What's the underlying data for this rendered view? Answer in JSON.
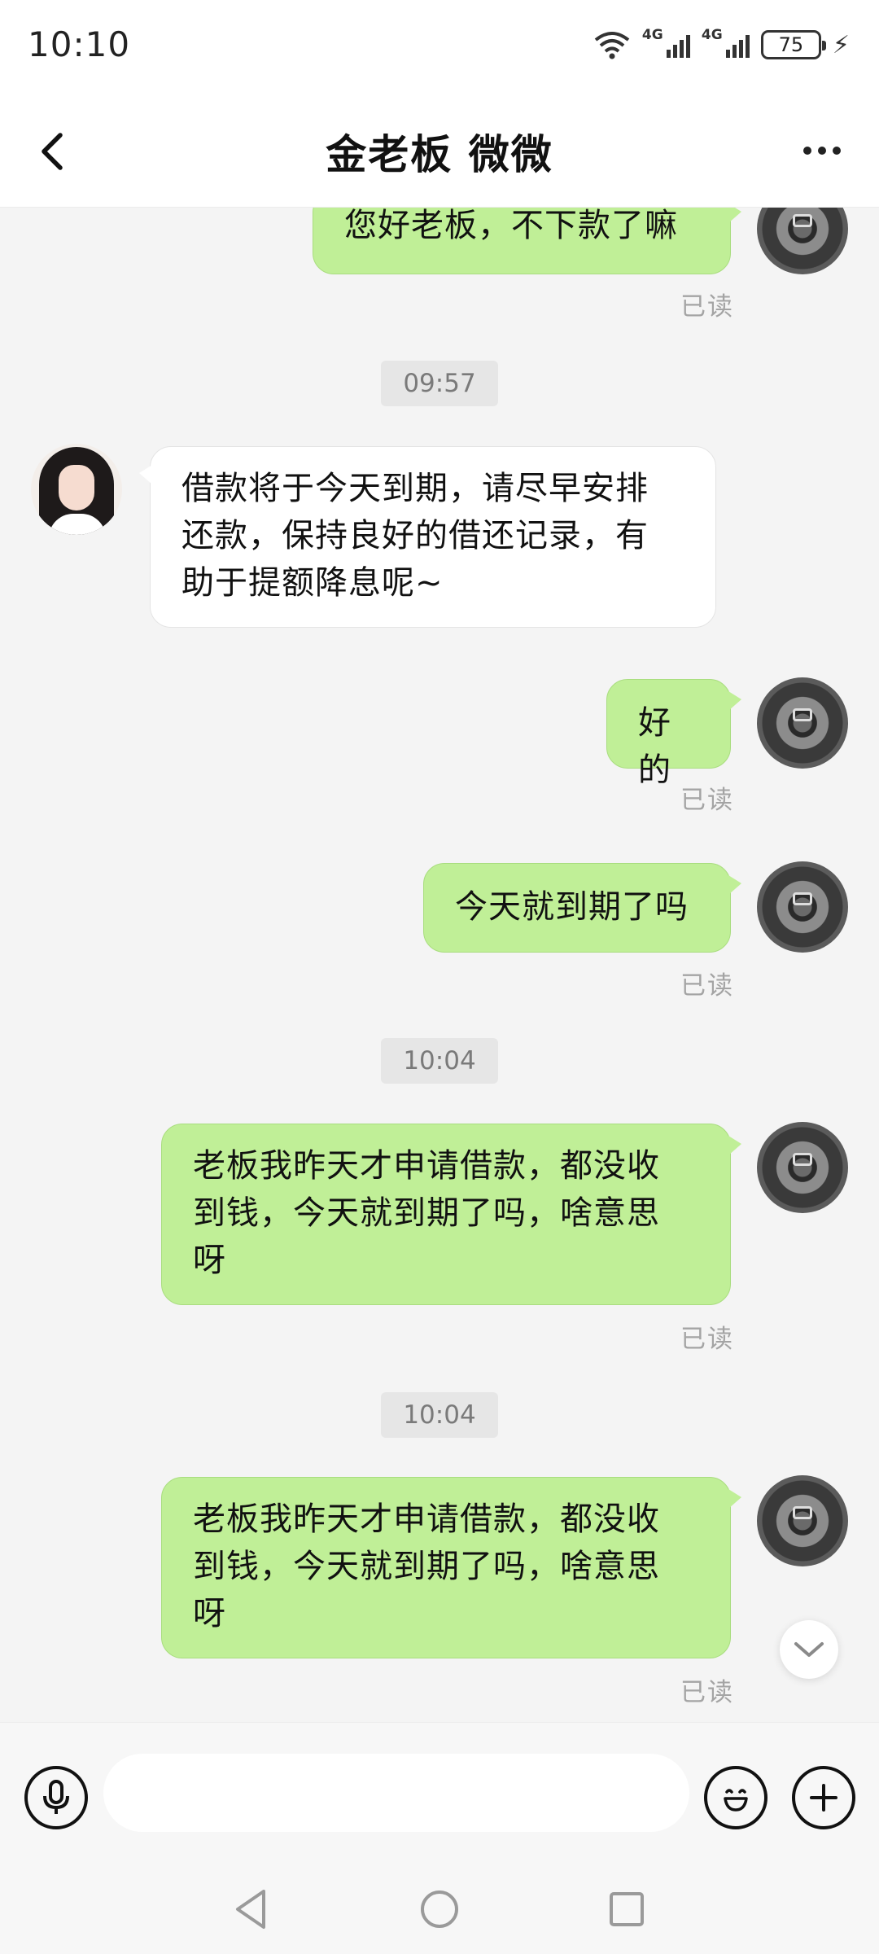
{
  "status_bar": {
    "time": "10:10",
    "battery": "75",
    "sim1_label": "4G",
    "sim2_label": "4G"
  },
  "header": {
    "title": "金老板 微微",
    "back_icon": "chevron-left-icon",
    "more_icon": "more-dots-icon"
  },
  "messages": [
    {
      "direction": "out",
      "text": "您好老板，不下款了嘛",
      "read": "已读"
    },
    {
      "type": "timestamp",
      "text": "09:57"
    },
    {
      "direction": "in",
      "lines": [
        "借款将于今天到期，请尽早安排",
        "还款，保持良好的借还记录，有",
        "助于提额降息呢~"
      ]
    },
    {
      "direction": "out",
      "text": "好的",
      "read": "已读"
    },
    {
      "direction": "out",
      "text": "今天就到期了吗",
      "read": "已读"
    },
    {
      "type": "timestamp",
      "text": "10:04"
    },
    {
      "direction": "out",
      "lines": [
        "老板我昨天才申请借款，都没收",
        "到钱，今天就到期了吗，啥意思",
        "呀"
      ],
      "read": "已读"
    },
    {
      "type": "timestamp",
      "text": "10:04"
    },
    {
      "direction": "out",
      "lines": [
        "老板我昨天才申请借款，都没收",
        "到钱，今天就到期了吗，啥意思",
        "呀"
      ],
      "read": "已读"
    }
  ],
  "input_bar": {
    "message_value": "",
    "voice_icon": "microphone-icon",
    "emoji_icon": "emoji-icon",
    "add_icon": "plus-icon"
  },
  "colors": {
    "outgoing_bubble": "#c0ef97",
    "incoming_bubble": "#ffffff",
    "chat_background": "#f4f4f4"
  }
}
